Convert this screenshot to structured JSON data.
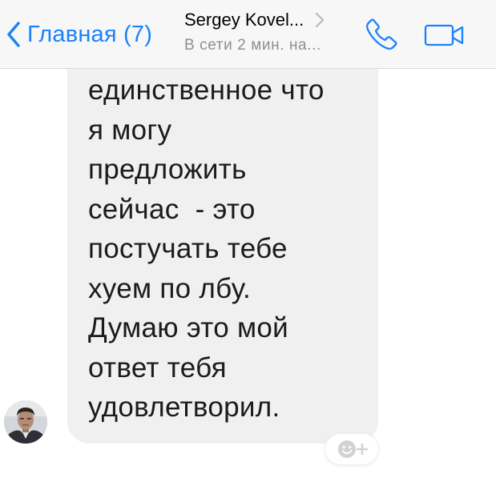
{
  "header": {
    "back_label": "Главная (7)",
    "contact_name": "Sergey Kovel...",
    "status": "В сети 2 мин. на..."
  },
  "message": {
    "lines": [
      "единственное что",
      "я могу",
      "предложить",
      "сейчас  - это",
      "постучать тебе",
      "хуем по лбу.",
      "Думаю это мой",
      "ответ тебя",
      "удовлетворил."
    ]
  },
  "icons": {
    "back": "chevron-left-icon",
    "title_chevron": "chevron-right-icon",
    "call": "phone-icon",
    "video": "video-camera-icon",
    "reaction": "emoji-add-icon"
  },
  "colors": {
    "accent": "#1a82fb",
    "bubble": "#f0f0f0",
    "header_bg": "#f7f7f8",
    "status_text": "#8e8e93",
    "message_text": "#1b1b1b"
  }
}
